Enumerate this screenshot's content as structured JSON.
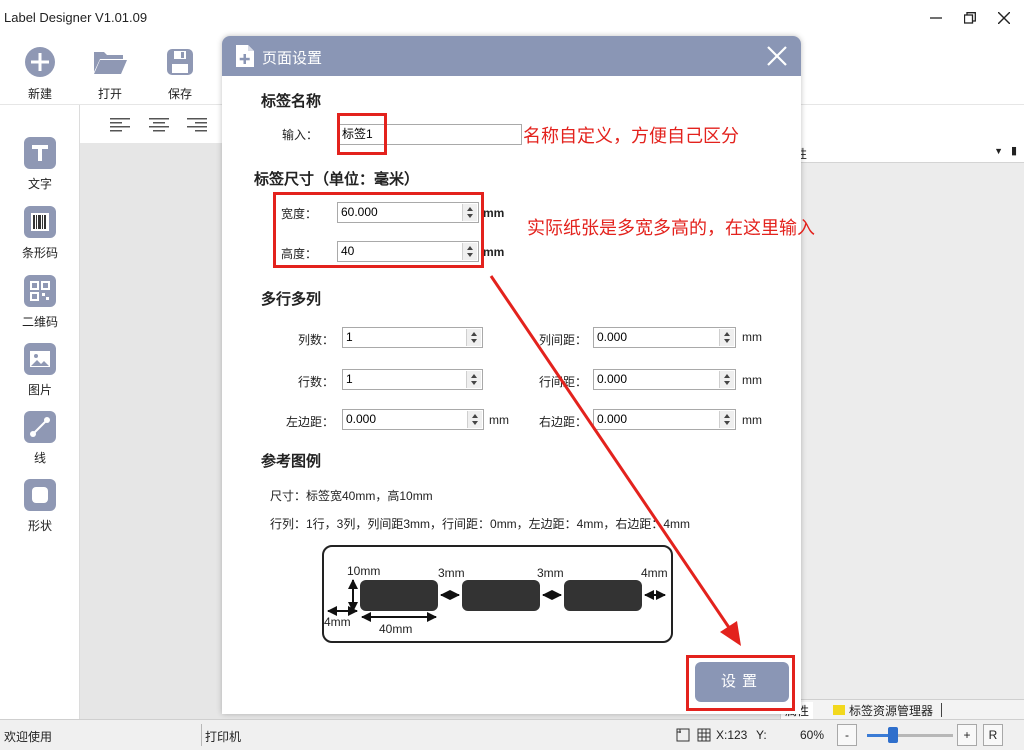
{
  "window": {
    "title": "Label Designer V1.01.09"
  },
  "toolbar": [
    {
      "label": "新建",
      "icon": "plus-icon"
    },
    {
      "label": "打开",
      "icon": "folder-open-icon"
    },
    {
      "label": "保存",
      "icon": "save-icon"
    }
  ],
  "sidebar": [
    {
      "label": "文字",
      "icon": "text-icon"
    },
    {
      "label": "条形码",
      "icon": "barcode-icon"
    },
    {
      "label": "二维码",
      "icon": "qrcode-icon"
    },
    {
      "label": "图片",
      "icon": "image-icon"
    },
    {
      "label": "线",
      "icon": "line-icon"
    },
    {
      "label": "形状",
      "icon": "shape-icon"
    }
  ],
  "right_panel": {
    "head_text": "性",
    "tab_props": "属性",
    "tab_resources": "标签资源管理器"
  },
  "status": {
    "welcome": "欢迎使用",
    "printer": "打印机",
    "coord_x": "X:123",
    "coord_y": "Y:",
    "zoom": "60%",
    "zoom_minus": "-",
    "zoom_plus": "+",
    "reset": "R",
    "zoom_level": 0.3
  },
  "dialog": {
    "title": "页面设置",
    "name_section": {
      "title": "标签名称",
      "label": "输入：",
      "value": "标签1"
    },
    "size_section": {
      "title": "标签尺寸（单位：毫米）",
      "width_label": "宽度：",
      "width_value": "60.000",
      "height_label": "高度：",
      "height_value": "40",
      "unit": "mm"
    },
    "grid_section": {
      "title": "多行多列",
      "cols_label": "列数：",
      "cols_value": "1",
      "rows_label": "行数：",
      "rows_value": "1",
      "left_label": "左边距：",
      "left_value": "0.000",
      "col_gap_label": "列间距：",
      "col_gap_value": "0.000",
      "row_gap_label": "行间距：",
      "row_gap_value": "0.000",
      "right_label": "右边距：",
      "right_value": "0.000",
      "unit": "mm"
    },
    "reference": {
      "title": "参考图例",
      "line1": "尺寸：标签宽40mm，高10mm",
      "line2": "行列：1行，3列，列间距3mm，行间距：0mm，左边距：4mm，右边距：4mm",
      "d_10mm": "10mm",
      "d_3mm_a": "3mm",
      "d_3mm_b": "3mm",
      "d_4mm_r": "4mm",
      "d_4mm_l": "4mm",
      "d_40mm": "40mm"
    },
    "set_button": "设置"
  },
  "annotations": {
    "name_note": "名称自定义，方便自己区分",
    "size_note": "实际纸张是多宽多高的，在这里输入",
    "color": "#e3221d"
  },
  "colors": {
    "accent": "#8a96b5",
    "icon": "#8f98b4",
    "annotation": "#e3221d"
  }
}
